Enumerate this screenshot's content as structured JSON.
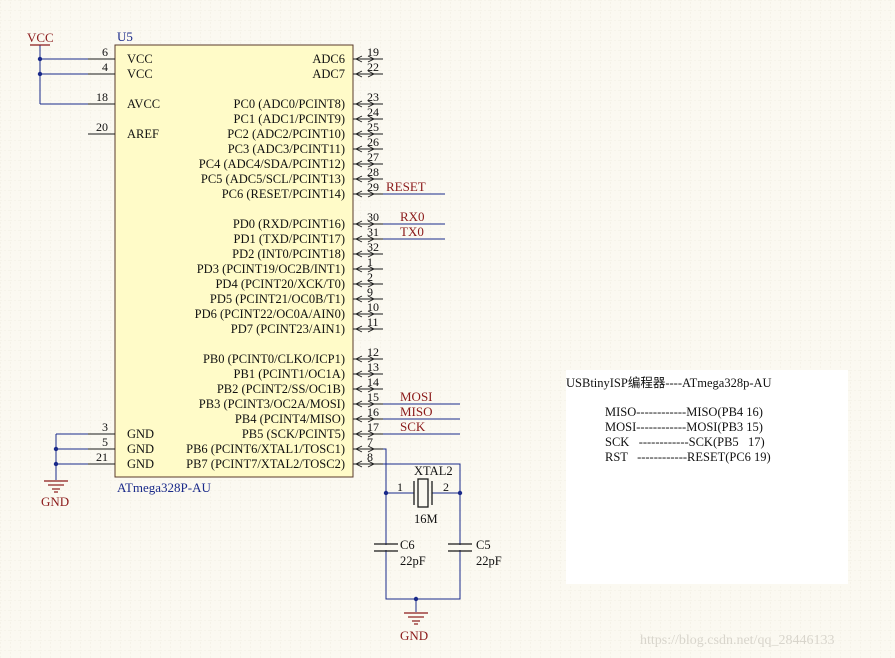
{
  "chip": {
    "designator": "U5",
    "part": "ATmega328P-AU",
    "pins_left": [
      {
        "num": "6",
        "name": "VCC"
      },
      {
        "num": "4",
        "name": "VCC"
      },
      {
        "num": "18",
        "name": "AVCC"
      },
      {
        "num": "20",
        "name": "AREF"
      },
      {
        "num": "3",
        "name": "GND"
      },
      {
        "num": "5",
        "name": "GND"
      },
      {
        "num": "21",
        "name": "GND"
      }
    ],
    "pins_right": [
      {
        "num": "19",
        "name": "ADC6"
      },
      {
        "num": "22",
        "name": "ADC7"
      },
      {
        "num": "23",
        "name": "PC0 (ADC0/PCINT8)"
      },
      {
        "num": "24",
        "name": "PC1 (ADC1/PCINT9)"
      },
      {
        "num": "25",
        "name": "PC2 (ADC2/PCINT10)"
      },
      {
        "num": "26",
        "name": "PC3 (ADC3/PCINT11)"
      },
      {
        "num": "27",
        "name": "PC4 (ADC4/SDA/PCINT12)"
      },
      {
        "num": "28",
        "name": "PC5 (ADC5/SCL/PCINT13)"
      },
      {
        "num": "29",
        "name": "PC6 (RESET/PCINT14)"
      },
      {
        "num": "30",
        "name": "PD0 (RXD/PCINT16)"
      },
      {
        "num": "31",
        "name": "PD1 (TXD/PCINT17)"
      },
      {
        "num": "32",
        "name": "PD2 (INT0/PCINT18)"
      },
      {
        "num": "1",
        "name": "PD3 (PCINT19/OC2B/INT1)"
      },
      {
        "num": "2",
        "name": "PD4 (PCINT20/XCK/T0)"
      },
      {
        "num": "9",
        "name": "PD5 (PCINT21/OC0B/T1)"
      },
      {
        "num": "10",
        "name": "PD6 (PCINT22/OC0A/AIN0)"
      },
      {
        "num": "11",
        "name": "PD7 (PCINT23/AIN1)"
      },
      {
        "num": "12",
        "name": "PB0 (PCINT0/CLKO/ICP1)"
      },
      {
        "num": "13",
        "name": "PB1 (PCINT1/OC1A)"
      },
      {
        "num": "14",
        "name": "PB2 (PCINT2/SS/OC1B)"
      },
      {
        "num": "15",
        "name": "PB3 (PCINT3/OC2A/MOSI)"
      },
      {
        "num": "16",
        "name": "PB4 (PCINT4/MISO)"
      },
      {
        "num": "17",
        "name": "PB5 (SCK/PCINT5)"
      },
      {
        "num": "7",
        "name": "PB6 (PCINT6/XTAL1/TOSC1)"
      },
      {
        "num": "8",
        "name": "PB7 (PCINT7/XTAL2/TOSC2)"
      }
    ]
  },
  "nets": {
    "vcc": "VCC",
    "gnd_left": "GND",
    "gnd_bottom": "GND",
    "reset": "RESET",
    "rx0": "RX0",
    "tx0": "TX0",
    "mosi": "MOSI",
    "miso": "MISO",
    "sck": "SCK"
  },
  "crystal": {
    "designator": "XTAL2",
    "value": "16M",
    "pin1": "1",
    "pin2": "2"
  },
  "caps": [
    {
      "designator": "C6",
      "value": "22pF"
    },
    {
      "designator": "C5",
      "value": "22pF"
    }
  ],
  "note": {
    "title": "USBtinyISP编程器----ATmega328p-AU",
    "lines": [
      "MISO------------MISO(PB4 16)",
      "MOSI------------MOSI(PB3 15)",
      "SCK   ------------SCK(PB5   17)",
      "RST   ------------RESET(PC6 19)"
    ]
  },
  "watermark": "https://blog.csdn.net/qq_28446133",
  "colors": {
    "background": "#fbf9f1",
    "chip_fill": "#fffbc8",
    "grid": "#e7e3d6",
    "net_label": "#8b1a1a",
    "designator": "#1a2a8a"
  }
}
